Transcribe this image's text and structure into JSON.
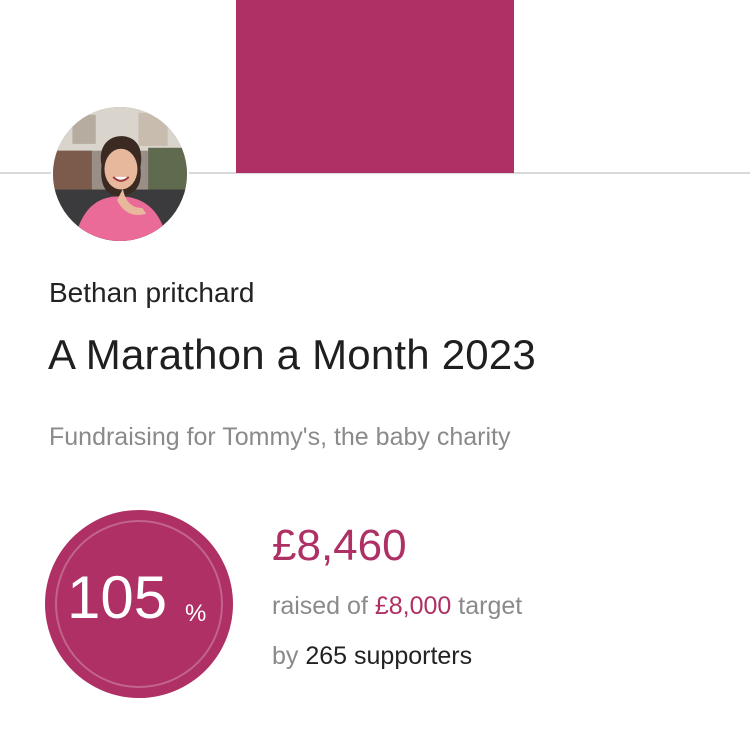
{
  "fundraiser": {
    "name": "Bethan pritchard",
    "title": "A Marathon a Month 2023",
    "charity_line": "Fundraising for Tommy's, the baby charity"
  },
  "progress": {
    "percent": "105",
    "percent_sign": "%",
    "percent_value": 105
  },
  "totals": {
    "raised": "£8,460",
    "raised_prefix": "raised of",
    "target": "£8,000",
    "target_suffix": "target",
    "supporters_prefix": "by",
    "supporters": "265 supporters"
  },
  "colors": {
    "accent": "#ae3064",
    "muted_text": "#8a8a8a",
    "dark_text": "#222222"
  },
  "icons": {
    "avatar": "profile-photo"
  }
}
